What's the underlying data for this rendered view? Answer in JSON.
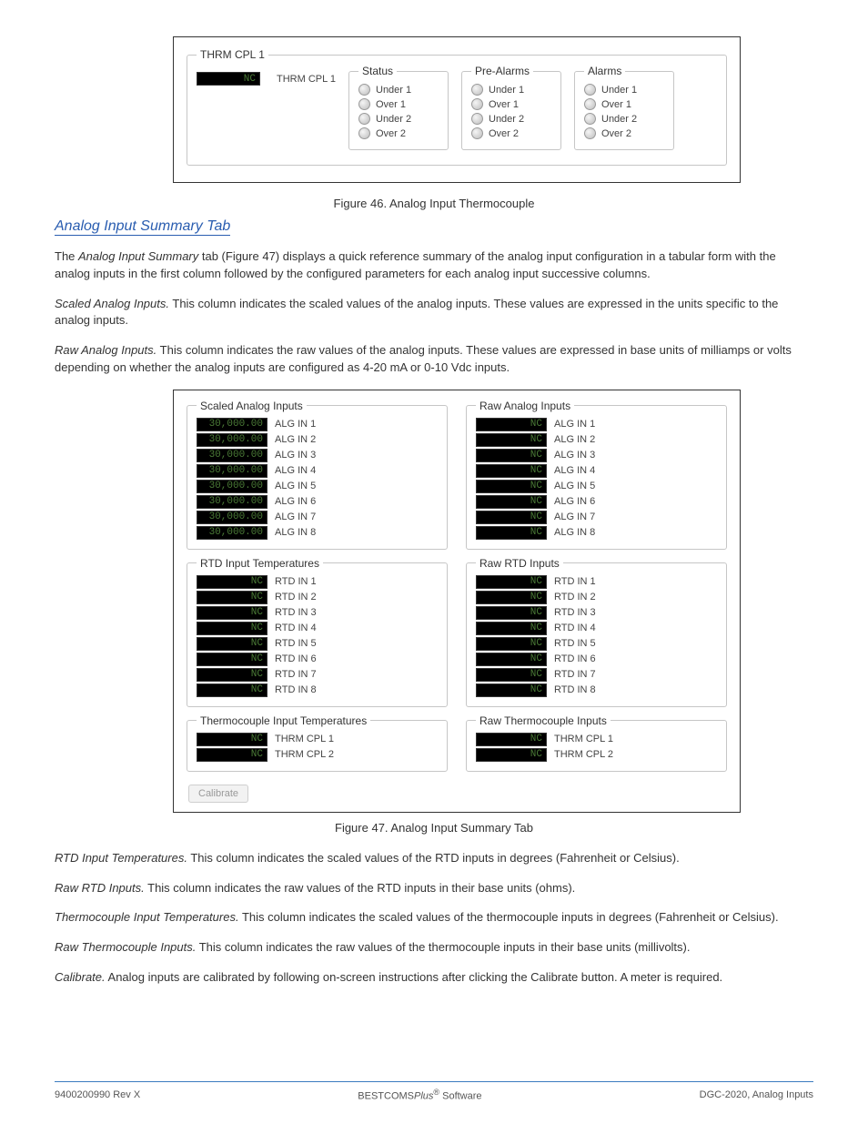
{
  "top_panel": {
    "legend": "THRM CPL 1",
    "value_label": "THRM CPL 1",
    "value_display": "NC",
    "status_legend": "Status",
    "prealarms_legend": "Pre-Alarms",
    "alarms_legend": "Alarms",
    "status_items": [
      "Under 1",
      "Over 1",
      "Under 2",
      "Over 2"
    ]
  },
  "figure_top_caption": "Figure 46. Analog Input Thermocouple",
  "figure_bottom_caption": "Figure 47. Analog Input Summary Tab",
  "link_text": "Analog Input Summary Tab",
  "para1_a": "The ",
  "para1_b": "Analog Input Summary",
  "para1_c": " tab (Figure 47) displays a quick reference summary of the analog input configuration in a tabular form with the analog inputs in the first column followed by the configured parameters for each analog input successive columns.",
  "para2_a": "Scaled Analog Inputs.",
  "para2_b": " This column indicates the scaled values of the analog inputs. These values are expressed in the units specific to the analog inputs.",
  "para3_a": "Raw Analog Inputs.",
  "para3_b": " This column indicates the raw values of the analog inputs. These values are expressed in base units of milliamps or volts depending on whether the analog inputs are configured as 4-20 mA or 0-10 Vdc inputs.",
  "mid_panel": {
    "scaled_legend": "Scaled Analog Inputs",
    "raw_alg_legend": "Raw Analog Inputs",
    "rtd_legend": "RTD Input Temperatures",
    "raw_rtd_legend": "Raw RTD Inputs",
    "tc_legend": "Thermocouple Input Temperatures",
    "raw_tc_legend": "Raw Thermocouple Inputs",
    "scaled_value": "30,000.00",
    "nc_value": "NC",
    "alg_rows": [
      "ALG IN 1",
      "ALG IN 2",
      "ALG IN 3",
      "ALG IN 4",
      "ALG IN 5",
      "ALG IN 6",
      "ALG IN 7",
      "ALG IN 8"
    ],
    "rtd_rows": [
      "RTD IN 1",
      "RTD IN 2",
      "RTD IN 3",
      "RTD IN 4",
      "RTD IN 5",
      "RTD IN 6",
      "RTD IN 7",
      "RTD IN 8"
    ],
    "tc_rows": [
      "THRM CPL 1",
      "THRM CPL 2"
    ],
    "calibrate_label": "Calibrate"
  },
  "para4_a": "RTD Input Temperatures.",
  "para4_b": " This column indicates the scaled values of the RTD inputs in degrees (Fahrenheit or Celsius).",
  "para5_a": "Raw RTD Inputs.",
  "para5_b": " This column indicates the raw values of the RTD inputs in their base units (ohms).",
  "para6_a": "Thermocouple Input Temperatures.",
  "para6_b": " This column indicates the scaled values of the thermocouple inputs in degrees (Fahrenheit or Celsius).",
  "para7_a": "Raw Thermocouple Inputs.",
  "para7_b": " This column indicates the raw values of the thermocouple inputs in their base units (millivolts).",
  "para8_a": "Calibrate.",
  "para8_b": " Analog inputs are calibrated by following on-screen instructions after clicking the Calibrate button. A meter is required.",
  "footer": {
    "left": "9400200990 Rev X",
    "center_a": "BESTCOMS",
    "center_b": "Plus",
    "center_c": " Software",
    "right": "DGC-2020, Analog Inputs"
  }
}
